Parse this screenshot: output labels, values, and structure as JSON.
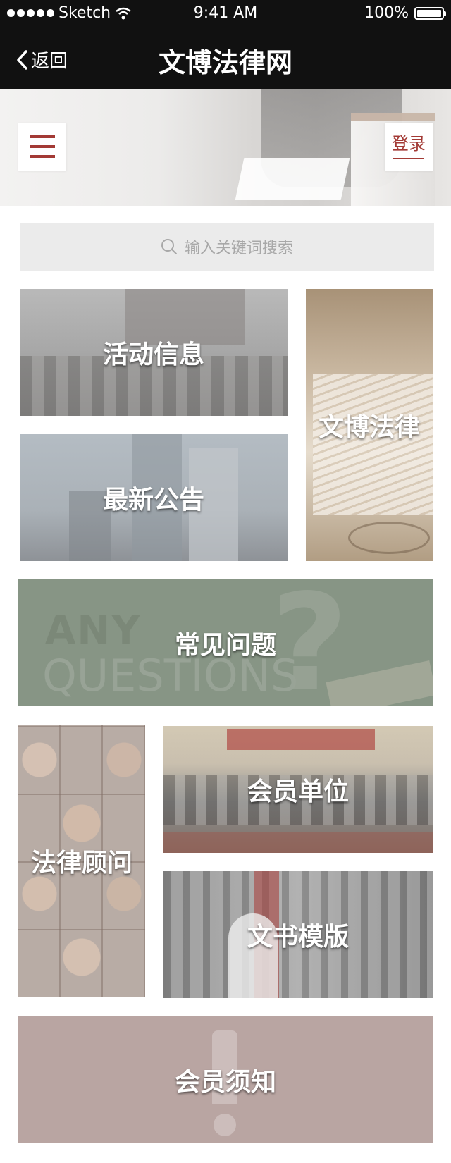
{
  "status_bar": {
    "carrier": "Sketch",
    "time": "9:41 AM",
    "battery": "100%"
  },
  "nav": {
    "back_label": "返回",
    "title": "文博法律网"
  },
  "header": {
    "login_label": "登录"
  },
  "search": {
    "placeholder": "输入关键词搜索"
  },
  "tiles": {
    "activity": "活动信息",
    "law": "文博法律",
    "notice": "最新公告",
    "faq": "常见问题",
    "faq_bg_line1": "ANY",
    "faq_bg_line2": "QUESTIONS",
    "faq_bg_mark": "?",
    "advisor": "法律顾问",
    "member": "会员单位",
    "template": "文书模版",
    "guide": "会员须知"
  },
  "colors": {
    "accent": "#a33a35",
    "bar": "#111111"
  },
  "icons": [
    "signal-icon",
    "wifi-icon",
    "battery-icon",
    "back-chevron-icon",
    "menu-icon",
    "search-icon"
  ]
}
